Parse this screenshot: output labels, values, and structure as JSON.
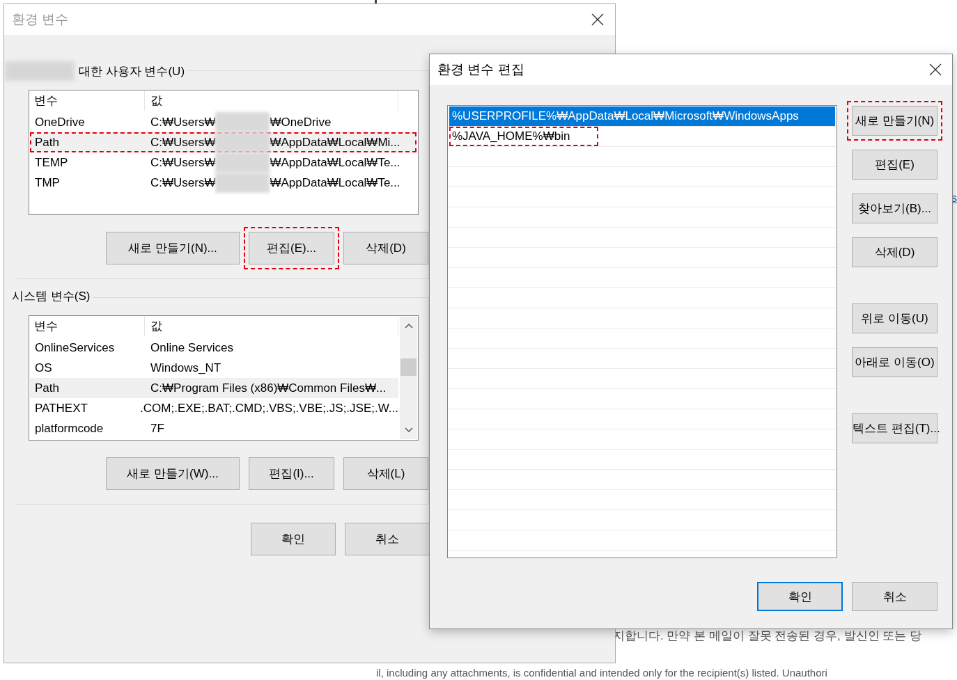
{
  "background_page": {
    "link_fragment": "s",
    "text_lines": [
      "지합니다. 만약 본 메일이 잘못 전송된 경우, 발신인 또는 당",
      "il, including any attachments, is confidential and intended only for the recipient(s) listed. Unauthori"
    ]
  },
  "env_dialog": {
    "title": "환경 변수",
    "user_variables": {
      "label": "대한 사용자 변수(U)",
      "owner_redacted": true,
      "columns": [
        "변수",
        "값"
      ],
      "rows": [
        {
          "name": "OneDrive",
          "value_before": "C:₩Users₩",
          "value_after": "₩OneDrive",
          "redacted": true,
          "selected": false,
          "highlighted": false
        },
        {
          "name": "Path",
          "value_before": "C:₩Users₩",
          "value_after": "₩AppData₩Local₩Mi...",
          "redacted": true,
          "selected": true,
          "highlighted": true
        },
        {
          "name": "TEMP",
          "value_before": "C:₩Users₩",
          "value_after": "₩AppData₩Local₩Te...",
          "redacted": true,
          "selected": false,
          "highlighted": false
        },
        {
          "name": "TMP",
          "value_before": "C:₩Users₩",
          "value_after": "₩AppData₩Local₩Te...",
          "redacted": true,
          "selected": false,
          "highlighted": false
        }
      ],
      "buttons": [
        {
          "label": "새로 만들기(N)...",
          "highlighted": false
        },
        {
          "label": "편집(E)...",
          "highlighted": true
        },
        {
          "label": "삭제(D)",
          "highlighted": false
        }
      ]
    },
    "system_variables": {
      "label": "시스템 변수(S)",
      "columns": [
        "변수",
        "값"
      ],
      "rows": [
        {
          "name": "OnlineServices",
          "value": "Online Services",
          "selected": false
        },
        {
          "name": "OS",
          "value": "Windows_NT",
          "selected": false
        },
        {
          "name": "Path",
          "value": "C:₩Program Files (x86)₩Common Files₩...",
          "selected": true
        },
        {
          "name": "PATHEXT",
          "value": ".COM;.EXE;.BAT;.CMD;.VBS;.VBE;.JS;.JSE;.W...",
          "selected": false
        },
        {
          "name": "platformcode",
          "value": "7F",
          "selected": false
        }
      ],
      "buttons": [
        {
          "label": "새로 만들기(W)...",
          "highlighted": false
        },
        {
          "label": "편집(I)...",
          "highlighted": false
        },
        {
          "label": "삭제(L)",
          "highlighted": false
        }
      ]
    },
    "buttons": [
      "확인",
      "취소"
    ]
  },
  "edit_dialog": {
    "title": "환경 변수 편집",
    "entries": [
      {
        "text": "%USERPROFILE%₩AppData₩Local₩Microsoft₩WindowsApps",
        "selected": true,
        "highlighted": false
      },
      {
        "text": "%JAVA_HOME%₩bin",
        "selected": false,
        "highlighted": true
      }
    ],
    "side_button_groups": [
      [
        {
          "label": "새로 만들기(N)",
          "highlighted": true
        },
        {
          "label": "편집(E)",
          "highlighted": false
        },
        {
          "label": "찾아보기(B)...",
          "highlighted": false
        },
        {
          "label": "삭제(D)",
          "highlighted": false
        }
      ],
      [
        {
          "label": "위로 이동(U)",
          "highlighted": false
        },
        {
          "label": "아래로 이동(O)",
          "highlighted": false
        }
      ],
      [
        {
          "label": "텍스트 편집(T)...",
          "highlighted": false
        }
      ]
    ],
    "footer_buttons": [
      {
        "label": "확인",
        "default": true
      },
      {
        "label": "취소",
        "default": false
      }
    ]
  }
}
